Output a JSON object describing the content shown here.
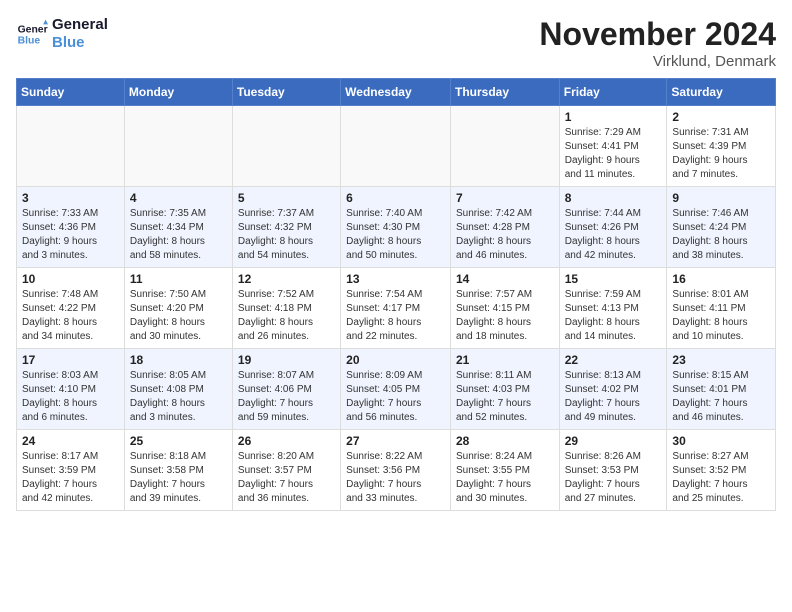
{
  "logo": {
    "line1": "General",
    "line2": "Blue"
  },
  "title": "November 2024",
  "location": "Virklund, Denmark",
  "days_header": [
    "Sunday",
    "Monday",
    "Tuesday",
    "Wednesday",
    "Thursday",
    "Friday",
    "Saturday"
  ],
  "weeks": [
    [
      {
        "day": "",
        "info": ""
      },
      {
        "day": "",
        "info": ""
      },
      {
        "day": "",
        "info": ""
      },
      {
        "day": "",
        "info": ""
      },
      {
        "day": "",
        "info": ""
      },
      {
        "day": "1",
        "info": "Sunrise: 7:29 AM\nSunset: 4:41 PM\nDaylight: 9 hours\nand 11 minutes."
      },
      {
        "day": "2",
        "info": "Sunrise: 7:31 AM\nSunset: 4:39 PM\nDaylight: 9 hours\nand 7 minutes."
      }
    ],
    [
      {
        "day": "3",
        "info": "Sunrise: 7:33 AM\nSunset: 4:36 PM\nDaylight: 9 hours\nand 3 minutes."
      },
      {
        "day": "4",
        "info": "Sunrise: 7:35 AM\nSunset: 4:34 PM\nDaylight: 8 hours\nand 58 minutes."
      },
      {
        "day": "5",
        "info": "Sunrise: 7:37 AM\nSunset: 4:32 PM\nDaylight: 8 hours\nand 54 minutes."
      },
      {
        "day": "6",
        "info": "Sunrise: 7:40 AM\nSunset: 4:30 PM\nDaylight: 8 hours\nand 50 minutes."
      },
      {
        "day": "7",
        "info": "Sunrise: 7:42 AM\nSunset: 4:28 PM\nDaylight: 8 hours\nand 46 minutes."
      },
      {
        "day": "8",
        "info": "Sunrise: 7:44 AM\nSunset: 4:26 PM\nDaylight: 8 hours\nand 42 minutes."
      },
      {
        "day": "9",
        "info": "Sunrise: 7:46 AM\nSunset: 4:24 PM\nDaylight: 8 hours\nand 38 minutes."
      }
    ],
    [
      {
        "day": "10",
        "info": "Sunrise: 7:48 AM\nSunset: 4:22 PM\nDaylight: 8 hours\nand 34 minutes."
      },
      {
        "day": "11",
        "info": "Sunrise: 7:50 AM\nSunset: 4:20 PM\nDaylight: 8 hours\nand 30 minutes."
      },
      {
        "day": "12",
        "info": "Sunrise: 7:52 AM\nSunset: 4:18 PM\nDaylight: 8 hours\nand 26 minutes."
      },
      {
        "day": "13",
        "info": "Sunrise: 7:54 AM\nSunset: 4:17 PM\nDaylight: 8 hours\nand 22 minutes."
      },
      {
        "day": "14",
        "info": "Sunrise: 7:57 AM\nSunset: 4:15 PM\nDaylight: 8 hours\nand 18 minutes."
      },
      {
        "day": "15",
        "info": "Sunrise: 7:59 AM\nSunset: 4:13 PM\nDaylight: 8 hours\nand 14 minutes."
      },
      {
        "day": "16",
        "info": "Sunrise: 8:01 AM\nSunset: 4:11 PM\nDaylight: 8 hours\nand 10 minutes."
      }
    ],
    [
      {
        "day": "17",
        "info": "Sunrise: 8:03 AM\nSunset: 4:10 PM\nDaylight: 8 hours\nand 6 minutes."
      },
      {
        "day": "18",
        "info": "Sunrise: 8:05 AM\nSunset: 4:08 PM\nDaylight: 8 hours\nand 3 minutes."
      },
      {
        "day": "19",
        "info": "Sunrise: 8:07 AM\nSunset: 4:06 PM\nDaylight: 7 hours\nand 59 minutes."
      },
      {
        "day": "20",
        "info": "Sunrise: 8:09 AM\nSunset: 4:05 PM\nDaylight: 7 hours\nand 56 minutes."
      },
      {
        "day": "21",
        "info": "Sunrise: 8:11 AM\nSunset: 4:03 PM\nDaylight: 7 hours\nand 52 minutes."
      },
      {
        "day": "22",
        "info": "Sunrise: 8:13 AM\nSunset: 4:02 PM\nDaylight: 7 hours\nand 49 minutes."
      },
      {
        "day": "23",
        "info": "Sunrise: 8:15 AM\nSunset: 4:01 PM\nDaylight: 7 hours\nand 46 minutes."
      }
    ],
    [
      {
        "day": "24",
        "info": "Sunrise: 8:17 AM\nSunset: 3:59 PM\nDaylight: 7 hours\nand 42 minutes."
      },
      {
        "day": "25",
        "info": "Sunrise: 8:18 AM\nSunset: 3:58 PM\nDaylight: 7 hours\nand 39 minutes."
      },
      {
        "day": "26",
        "info": "Sunrise: 8:20 AM\nSunset: 3:57 PM\nDaylight: 7 hours\nand 36 minutes."
      },
      {
        "day": "27",
        "info": "Sunrise: 8:22 AM\nSunset: 3:56 PM\nDaylight: 7 hours\nand 33 minutes."
      },
      {
        "day": "28",
        "info": "Sunrise: 8:24 AM\nSunset: 3:55 PM\nDaylight: 7 hours\nand 30 minutes."
      },
      {
        "day": "29",
        "info": "Sunrise: 8:26 AM\nSunset: 3:53 PM\nDaylight: 7 hours\nand 27 minutes."
      },
      {
        "day": "30",
        "info": "Sunrise: 8:27 AM\nSunset: 3:52 PM\nDaylight: 7 hours\nand 25 minutes."
      }
    ]
  ],
  "colors": {
    "header_bg": "#3a6bbf",
    "accent": "#4a90d9"
  }
}
